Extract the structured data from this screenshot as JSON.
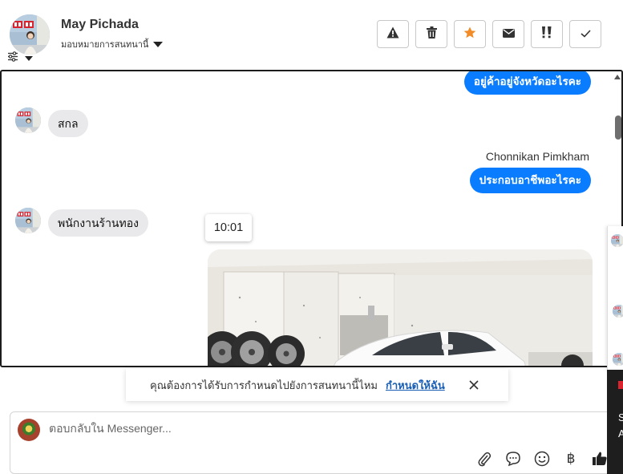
{
  "contact": {
    "name": "May Pichada",
    "assign_label": "มอบหมายการสนทนานี้"
  },
  "toolbar": {
    "buttons": [
      {
        "icon": "warning-icon"
      },
      {
        "icon": "trash-icon"
      },
      {
        "icon": "star-icon",
        "color": "#f28c28"
      },
      {
        "icon": "envelope-icon"
      },
      {
        "icon": "double-exclamation-icon"
      },
      {
        "icon": "check-icon"
      }
    ]
  },
  "messages": {
    "m1": "อยู่ค้าอยู่จังหวัดอะไรคะ",
    "m2": "สกล",
    "sender": "Chonnikan Pimkham",
    "m3": "ประกอบอาชีพอะไรคะ",
    "m4": "พนักงานร้านทอง",
    "time": "10:01"
  },
  "notice": {
    "text": "คุณต้องการได้รับการกำหนดไปยังการสนทนานี้ไหม",
    "link": "กำหนดให้ฉัน"
  },
  "composer": {
    "placeholder": "ตอบกลับใน Messenger...",
    "baht_symbol": "฿"
  },
  "side": {
    "t1": "S",
    "t2": "A"
  },
  "colors": {
    "outgoing_bubble": "#0a7cff",
    "incoming_bubble": "#e9e9eb",
    "link": "#1a5fb4",
    "star": "#f28c28"
  }
}
